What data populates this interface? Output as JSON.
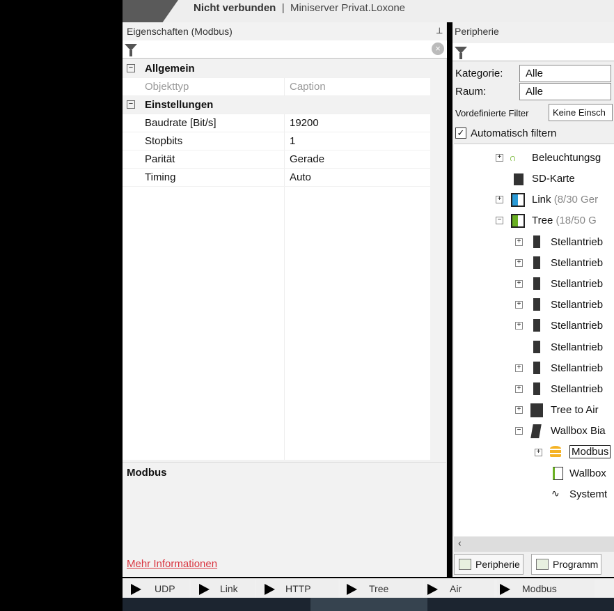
{
  "titlebar": {
    "status": "Nicht verbunden",
    "separator": "|",
    "project": "Miniserver Privat.Loxone"
  },
  "properties": {
    "title": "Eigenschaften (Modbus)",
    "pin_icon": "pin-icon",
    "categories": [
      {
        "label": "Allgemein",
        "rows": [
          {
            "name": "Objekttyp",
            "value": "Caption"
          }
        ]
      },
      {
        "label": "Einstellungen",
        "rows": [
          {
            "name": "Baudrate [Bit/s]",
            "value": "19200"
          },
          {
            "name": "Stopbits",
            "value": "1"
          },
          {
            "name": "Parität",
            "value": "Gerade"
          },
          {
            "name": "Timing",
            "value": "Auto"
          }
        ]
      }
    ],
    "description_title": "Modbus",
    "more_info": "Mehr Informationen"
  },
  "peripherie": {
    "title": "Peripherie",
    "kategorie_label": "Kategorie:",
    "kategorie_value": "Alle",
    "raum_label": "Raum:",
    "raum_value": "Alle",
    "predef_label": "Vordefinierte Filter",
    "predef_value": "Keine Einsch",
    "auto_filter": "Automatisch filtern",
    "tree": [
      "Beleuchtungsg",
      "SD-Karte",
      "Link",
      "(8/30 Ger",
      "Tree",
      "(18/50 G",
      "Stellantrieb",
      "Stellantrieb",
      "Stellantrieb",
      "Stellantrieb",
      "Stellantrieb",
      "Stellantrieb",
      "Stellantrieb",
      "Stellantrieb",
      "Tree to Air",
      "Wallbox Bia",
      "Modbus",
      "Wallbox",
      "Systemt"
    ],
    "tabs": [
      "Peripherie",
      "Programm"
    ]
  },
  "toolbar": [
    "UDP",
    "Link",
    "HTTP",
    "Tree",
    "Air",
    "Modbus"
  ],
  "colors": {
    "link": "#d9343f",
    "link_blue": "#2a9ad6",
    "tree_green": "#6ab023"
  }
}
